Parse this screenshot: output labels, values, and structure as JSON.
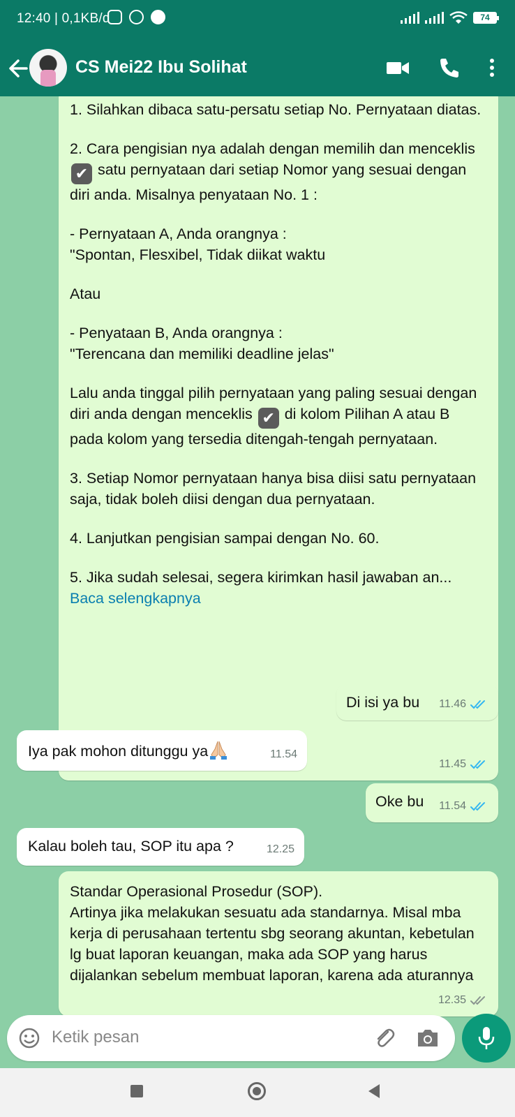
{
  "status_bar": {
    "time_speed": "12:40 | 0,1KB/d",
    "battery": "74",
    "icons": [
      "instagram-icon",
      "alarm-icon",
      "spotify-icon",
      "signal-icon",
      "signal-icon",
      "wifi-icon",
      "battery-icon"
    ]
  },
  "header": {
    "contact_name": "CS Mei22 Ibu Solihat",
    "icons": [
      "back-arrow-icon",
      "video-call-icon",
      "phone-icon",
      "more-vert-icon"
    ]
  },
  "messages": [
    {
      "direction": "outgoing",
      "p1": "1. Silahkan dibaca satu-persatu setiap No. Pernyataan diatas.",
      "p2_a": "2. Cara pengisian nya adalah dengan memilih dan menceklis ",
      "p2_b": " satu pernyataan dari setiap Nomor yang sesuai dengan diri anda. Misalnya penyataan No. 1 :",
      "p3": "- Pernyataan A, Anda orangnya :\n\"Spontan, Flesxibel, Tidak diikat waktu",
      "p4": "Atau",
      "p5": "- Penyataan B, Anda orangnya :\n\"Terencana dan memiliki deadline jelas\"",
      "p6_a": "Lalu anda tinggal pilih pernyataan yang paling sesuai dengan diri anda dengan menceklis ",
      "p6_b": " di kolom Pilihan A atau B pada kolom yang tersedia ditengah-tengah pernyataan.",
      "p7": "3. Setiap Nomor pernyataan hanya bisa diisi satu pernyataan saja, tidak boleh diisi dengan dua pernyataan.",
      "p8": "4. Lanjutkan pengisian sampai dengan No. 60.",
      "p9": "5. Jika sudah selesai, segera kirimkan hasil jawaban an... ",
      "read_more": "Baca selengkapnya",
      "time": "11.45",
      "check_glyph": "✔"
    },
    {
      "direction": "outgoing",
      "text": "Di isi ya bu",
      "time": "11.46"
    },
    {
      "direction": "incoming",
      "text": "Iya pak mohon ditunggu ya",
      "emoji": "folded-hands-icon",
      "time": "11.54"
    },
    {
      "direction": "outgoing",
      "text": "Oke bu",
      "time": "11.54"
    },
    {
      "direction": "incoming",
      "text": "Kalau boleh tau, SOP itu apa ?",
      "time": "12.25"
    },
    {
      "direction": "outgoing",
      "text": "Standar Operasional Prosedur (SOP).\nArtinya jika melakukan sesuatu ada standarnya. Misal mba kerja di perusahaan tertentu sbg seorang akuntan, kebetulan lg buat laporan keuangan, maka ada SOP yang harus dijalankan sebelum membuat laporan, karena ada aturannya",
      "time": "12.35"
    }
  ],
  "input": {
    "placeholder": "Ketik pesan"
  },
  "colors": {
    "header": "#0b7a66",
    "chat_bg": "#8ccfa6",
    "outgoing_bubble": "#e1fcd3",
    "incoming_bubble": "#ffffff",
    "read_ticks": "#34b7f1",
    "mic_button": "#0b9a7a"
  }
}
